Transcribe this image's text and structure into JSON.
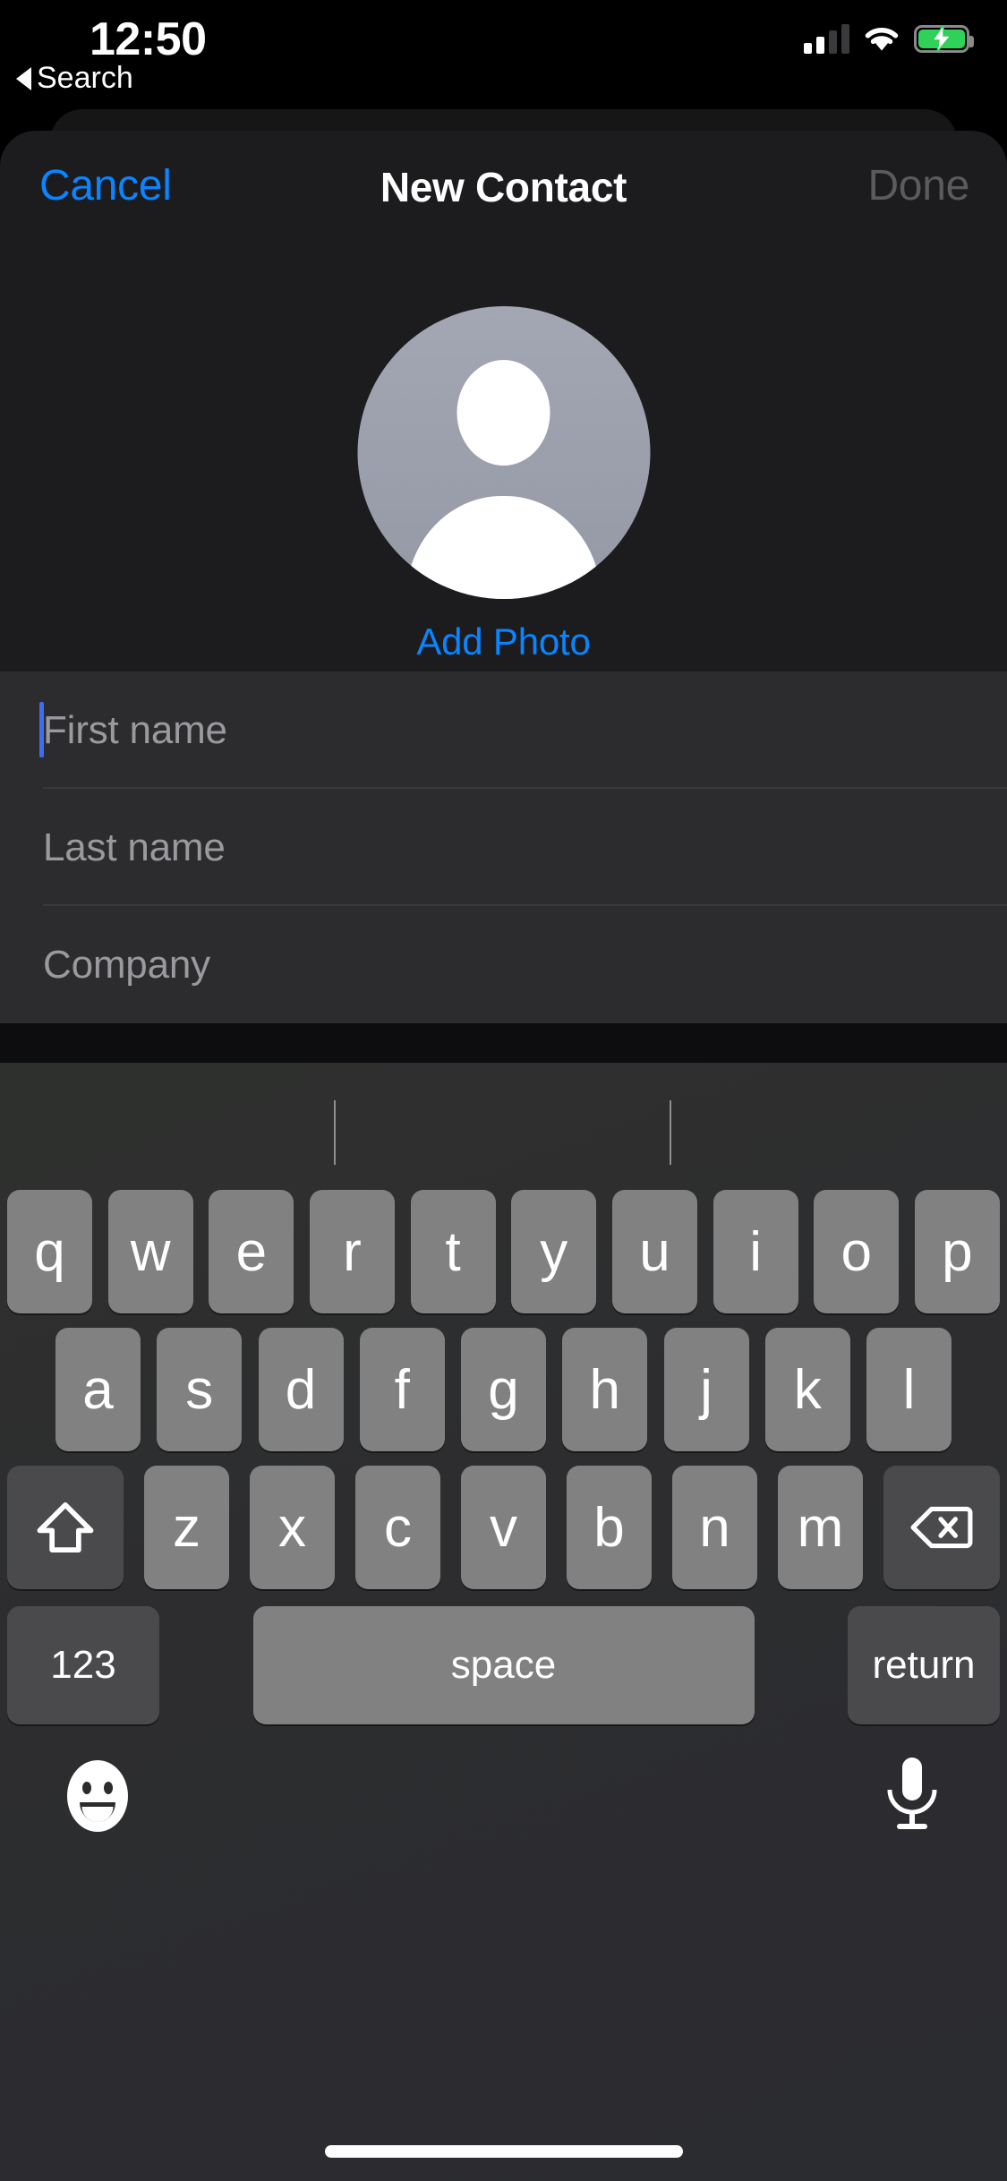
{
  "status_bar": {
    "time": "12:50",
    "back_label": "Search",
    "cellular_icon": "cellular-bars-icon",
    "wifi_icon": "wifi-icon",
    "battery_icon": "battery-charging-icon",
    "battery_color": "#30d158"
  },
  "navbar": {
    "cancel_label": "Cancel",
    "title": "New Contact",
    "done_label": "Done",
    "cancel_color": "#0a84ff",
    "done_color": "#5b5b5e"
  },
  "avatar": {
    "icon": "person-placeholder-icon",
    "add_photo_label": "Add Photo",
    "add_photo_color": "#0a84ff",
    "circle_color": "#9b9fac"
  },
  "form": {
    "fields": [
      {
        "placeholder": "First name",
        "value": "",
        "focused": true
      },
      {
        "placeholder": "Last name",
        "value": "",
        "focused": false
      },
      {
        "placeholder": "Company",
        "value": "",
        "focused": false
      }
    ],
    "caret_color": "#3d6ef0"
  },
  "keyboard": {
    "predictive_suggestions": [
      "",
      "",
      ""
    ],
    "row1": [
      "q",
      "w",
      "e",
      "r",
      "t",
      "y",
      "u",
      "i",
      "o",
      "p"
    ],
    "row2": [
      "a",
      "s",
      "d",
      "f",
      "g",
      "h",
      "j",
      "k",
      "l"
    ],
    "row3_letters": [
      "z",
      "x",
      "c",
      "v",
      "b",
      "n",
      "m"
    ],
    "shift_icon": "shift-arrow-icon",
    "delete_icon": "backspace-delete-icon",
    "numbers_label": "123",
    "space_label": "space",
    "return_label": "return",
    "emoji_icon": "emoji-smiley-icon",
    "dictation_icon": "microphone-icon",
    "key_color": "#818181",
    "modifier_key_color": "#4a4a4c"
  },
  "home_indicator": {
    "label": "home-indicator"
  }
}
